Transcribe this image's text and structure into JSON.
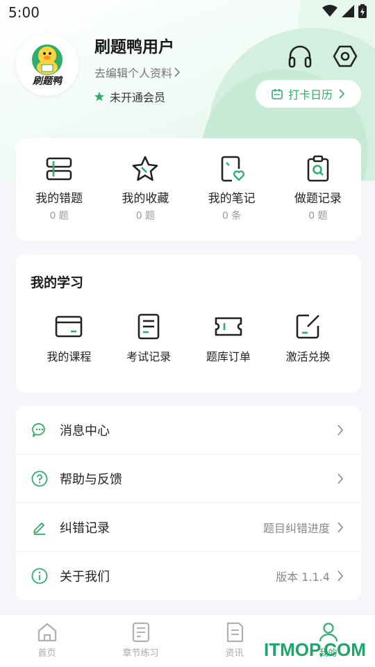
{
  "status_bar": {
    "time": "5:00"
  },
  "profile": {
    "username": "刷题鸭用户",
    "edit_link": "去编辑个人资料",
    "member_status": "未开通会员",
    "avatar_logo_text": "刷题鸭",
    "checkin_label": "打卡日历"
  },
  "quick_actions": [
    {
      "label": "我的错题",
      "count": "0 题",
      "icon": "wrong-questions-icon"
    },
    {
      "label": "我的收藏",
      "count": "0 题",
      "icon": "star-icon"
    },
    {
      "label": "我的笔记",
      "count": "0 条",
      "icon": "notes-icon"
    },
    {
      "label": "做题记录",
      "count": "0 题",
      "icon": "clipboard-search-icon"
    }
  ],
  "study": {
    "title": "我的学习",
    "items": [
      {
        "label": "我的课程",
        "icon": "course-card-icon"
      },
      {
        "label": "考试记录",
        "icon": "document-icon"
      },
      {
        "label": "题库订单",
        "icon": "ticket-icon"
      },
      {
        "label": "激活兑换",
        "icon": "edit-square-icon"
      }
    ]
  },
  "menu": [
    {
      "label": "消息中心",
      "right_text": "",
      "icon": "message-icon"
    },
    {
      "label": "帮助与反馈",
      "right_text": "",
      "icon": "help-icon"
    },
    {
      "label": "纠错记录",
      "right_text": "题目纠错进度",
      "icon": "pencil-icon"
    },
    {
      "label": "关于我们",
      "right_text": "版本 1.1.4",
      "icon": "info-icon"
    }
  ],
  "tabs": [
    {
      "label": "首页",
      "icon": "home-icon",
      "active": false
    },
    {
      "label": "章节练习",
      "icon": "chapter-practice-icon",
      "active": false
    },
    {
      "label": "资讯",
      "icon": "news-icon",
      "active": false
    },
    {
      "label": "我的",
      "icon": "profile-icon",
      "active": true
    }
  ],
  "watermark": "ITMOP.COM",
  "colors": {
    "accent": "#2fae6a",
    "background": "#f4f6f9",
    "text": "#222222"
  }
}
